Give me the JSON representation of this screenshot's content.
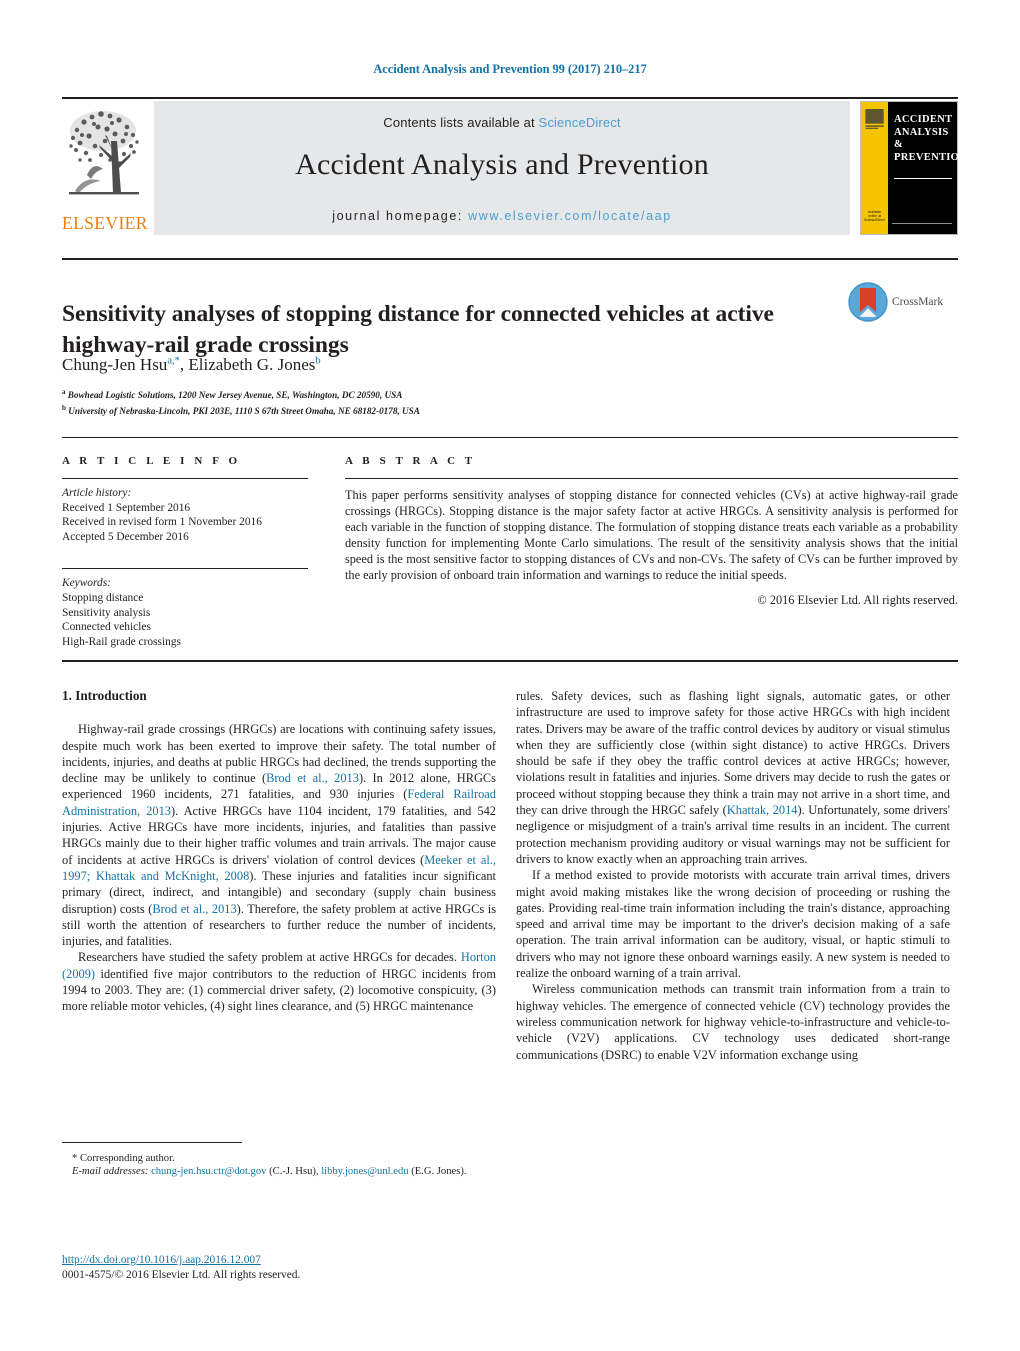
{
  "running_head": "Accident Analysis and Prevention 99 (2017) 210–217",
  "masthead": {
    "publisher_name": "ELSEVIER",
    "contents_prefix": "Contents lists available at ",
    "contents_link": "ScienceDirect",
    "journal_title": "Accident Analysis and Prevention",
    "homepage_prefix": "journal homepage: ",
    "homepage_url": "www.elsevier.com/locate/aap",
    "cover": {
      "line1": "ACCIDENT",
      "line2": "ANALYSIS",
      "line3": "&",
      "line4": "PREVENTION",
      "strip_caption": "available online at ScienceDirect"
    }
  },
  "article": {
    "title": "Sensitivity analyses of stopping distance for connected vehicles at active highway-rail grade crossings",
    "crossmark_label": "CrossMark",
    "authors": [
      {
        "name": "Chung-Jen Hsu",
        "sup": "a,",
        "star": "*"
      },
      {
        "name": "Elizabeth G. Jones",
        "sup": "b",
        "star": ""
      }
    ],
    "affiliations": [
      {
        "mark": "a",
        "text": "Bowhead Logistic Solutions, 1200 New Jersey Avenue, SE, Washington, DC 20590, USA"
      },
      {
        "mark": "b",
        "text": "University of Nebraska-Lincoln, PKI 203E, 1110 S 67th Street Omaha, NE 68182-0178, USA"
      }
    ]
  },
  "article_info": {
    "heading": "A R T I C L E   I N F O",
    "history_label": "Article history:",
    "history": [
      "Received 1 September 2016",
      "Received in revised form 1 November 2016",
      "Accepted 5 December 2016"
    ],
    "keywords_label": "Keywords:",
    "keywords": [
      "Stopping distance",
      "Sensitivity analysis",
      "Connected vehicles",
      "High-Rail grade crossings"
    ]
  },
  "abstract": {
    "heading": "A B S T R A C T",
    "text": "This paper performs sensitivity analyses of stopping distance for connected vehicles (CVs) at active highway-rail grade crossings (HRGCs). Stopping distance is the major safety factor at active HRGCs. A sensitivity analysis is performed for each variable in the function of stopping distance. The formulation of stopping distance treats each variable as a probability density function for implementing Monte Carlo simulations. The result of the sensitivity analysis shows that the initial speed is the most sensitive factor to stopping distances of CVs and non-CVs. The safety of CVs can be further improved by the early provision of onboard train information and warnings to reduce the initial speeds.",
    "copyright": "© 2016 Elsevier Ltd. All rights reserved."
  },
  "introduction": {
    "section_title": "1.  Introduction",
    "left_paragraphs": [
      "Highway-rail grade crossings (HRGCs) are locations with continuing safety issues, despite much work has been exerted to improve their safety. The total number of incidents, injuries, and deaths at public HRGCs had declined, the trends supporting the decline may be unlikely to continue (Brod et al., 2013). In 2012 alone, HRGCs experienced 1960 incidents, 271 fatalities, and 930 injuries (Federal Railroad Administration, 2013). Active HRGCs have 1104 incident, 179 fatalities, and 542 injuries. Active HRGCs have more incidents, injuries, and fatalities than passive HRGCs mainly due to their higher traffic volumes and train arrivals. The major cause of incidents at active HRGCs is drivers' violation of control devices (Meeker et al., 1997; Khattak and McKnight, 2008). These injuries and fatalities incur significant primary (direct, indirect, and intangible) and secondary (supply chain business disruption) costs (Brod et al., 2013). Therefore, the safety problem at active HRGCs is still worth the attention of researchers to further reduce the number of incidents, injuries, and fatalities.",
      "Researchers have studied the safety problem at active HRGCs for decades. Horton (2009) identified five major contributors to the reduction of HRGC incidents from 1994 to 2003. They are: (1) commercial driver safety, (2) locomotive conspicuity, (3) more reliable motor vehicles, (4) sight lines clearance, and (5) HRGC maintenance"
    ],
    "right_paragraphs": [
      "rules. Safety devices, such as flashing light signals, automatic gates, or other infrastructure are used to improve safety for those active HRGCs with high incident rates. Drivers may be aware of the traffic control devices by auditory or visual stimulus when they are sufficiently close (within sight distance) to active HRGCs. Drivers should be safe if they obey the traffic control devices at active HRGCs; however, violations result in fatalities and injuries. Some drivers may decide to rush the gates or proceed without stopping because they think a train may not arrive in a short time, and they can drive through the HRGC safely (Khattak, 2014). Unfortunately, some drivers' negligence or misjudgment of a train's arrival time results in an incident. The current protection mechanism providing auditory or visual warnings may not be sufficient for drivers to know exactly when an approaching train arrives.",
      "If a method existed to provide motorists with accurate train arrival times, drivers might avoid making mistakes like the wrong decision of proceeding or rushing the gates. Providing real-time train information including the train's distance, approaching speed and arrival time may be important to the driver's decision making of a safe operation. The train arrival information can be auditory, visual, or haptic stimuli to drivers who may not ignore these onboard warnings easily. A new system is needed to realize the onboard warning of a train arrival.",
      "Wireless communication methods can transmit train information from a train to highway vehicles. The emergence of connected vehicle (CV) technology provides the wireless communication network for highway vehicle-to-infrastructure and vehicle-to-vehicle (V2V) applications. CV technology uses dedicated short-range communications (DSRC) to enable V2V information exchange using"
    ],
    "citations_left": [
      "Brod et al., 2013",
      "Federal Railroad Administration, 2013",
      "Meeker et al., 1997; Khattak and McKnight, 2008",
      "Brod et al., 2013",
      "Horton (2009)"
    ],
    "citations_right": [
      "Khattak, 2014"
    ]
  },
  "footnote": {
    "corresponding_marker": "*",
    "corresponding_text": "Corresponding author.",
    "email_label": "E-mail addresses:",
    "email1": "chung-jen.hsu.ctr@dot.gov",
    "email1_owner": "(C.-J. Hsu),",
    "email2": "libby.jones@unl.edu",
    "email2_owner": "(E.G. Jones)."
  },
  "doi": {
    "url": "http://dx.doi.org/10.1016/j.aap.2016.12.007",
    "issn_line": "0001-4575/© 2016 Elsevier Ltd. All rights reserved."
  },
  "colors": {
    "link_blue": "#1474a4",
    "sd_blue": "#4a9fd4",
    "elsevier_orange": "#f07f09",
    "cover_yellow": "#f5c400",
    "panel_gray": "#e6e7e8",
    "ink": "#231f20"
  }
}
